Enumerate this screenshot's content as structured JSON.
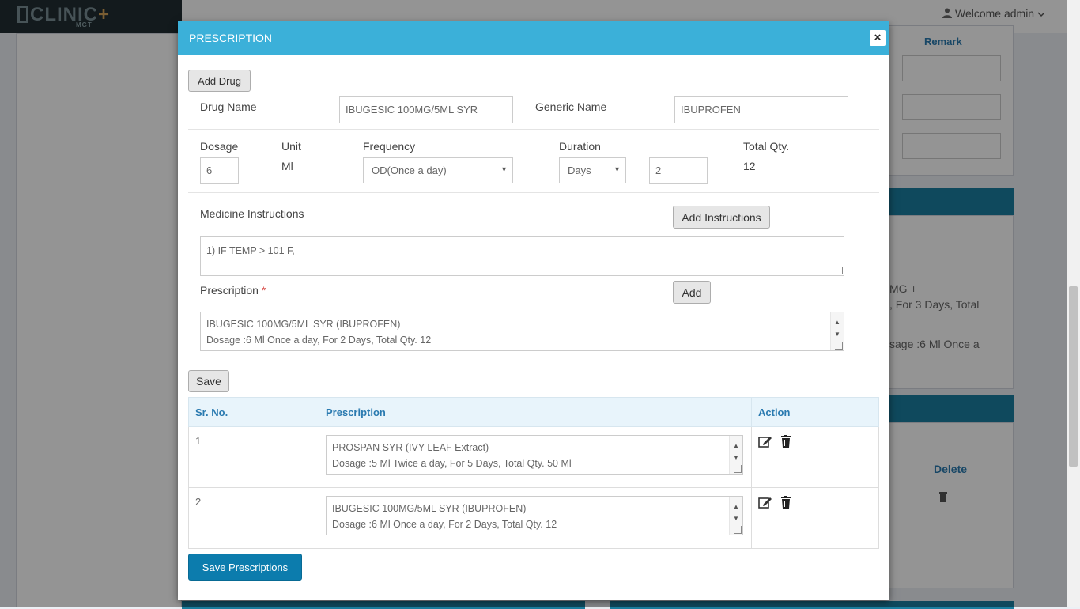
{
  "header": {
    "logo_text": "CLINIC+",
    "logo_sub": "MGT",
    "welcome": "Welcome admin"
  },
  "background": {
    "remark_header": "Remark",
    "delete_header": "Delete",
    "snippet_1": "MG +",
    "snippet_2": ", For 3 Days, Total",
    "snippet_3": "sage :6 Ml Once a"
  },
  "modal": {
    "title": "PRESCRIPTION",
    "close_label": "×",
    "add_drug_label": "Add Drug",
    "drug_name_label": "Drug Name",
    "drug_name_value": "IBUGESIC 100MG/5ML SYR",
    "generic_name_label": "Generic Name",
    "generic_name_value": "IBUPROFEN",
    "dosage_label": "Dosage",
    "dosage_value": "6",
    "unit_label": "Unit",
    "unit_value": "Ml",
    "frequency_label": "Frequency",
    "frequency_value": "OD(Once a day)",
    "duration_label": "Duration",
    "duration_unit": "Days",
    "duration_value": "2",
    "total_qty_label": "Total Qty.",
    "total_qty_value": "12",
    "instructions_label": "Medicine Instructions",
    "add_instructions_label": "Add Instructions",
    "instructions_text": "1) IF TEMP > 101 F,",
    "prescription_label": "Prescription",
    "required_mark": "*",
    "add_label": "Add",
    "prescription_line1": "IBUGESIC 100MG/5ML SYR (IBUPROFEN)",
    "prescription_line2": "Dosage :6 Ml Once a day, For 2 Days, Total Qty. 12",
    "save_label": "Save",
    "save_prescriptions_label": "Save Prescriptions"
  },
  "table": {
    "headers": [
      "Sr. No.",
      "Prescription",
      "Action"
    ],
    "rows": [
      {
        "sr": "1",
        "line1": "PROSPAN SYR (IVY LEAF Extract)",
        "line2": "Dosage :5 Ml Twice a day, For 5 Days, Total Qty. 50 Ml"
      },
      {
        "sr": "2",
        "line1": "IBUGESIC 100MG/5ML SYR (IBUPROFEN)",
        "line2": "Dosage :6 Ml Once a day, For 2 Days, Total Qty. 12"
      }
    ]
  },
  "icons": {
    "user": "user-icon",
    "caret": "chevron-down-icon",
    "edit": "edit-icon",
    "trash": "trash-icon"
  },
  "colors": {
    "modal_header": "#3bb0d9",
    "primary_button": "#0c7cad",
    "table_header_text": "#2a7ab0",
    "required": "#d9534f"
  }
}
